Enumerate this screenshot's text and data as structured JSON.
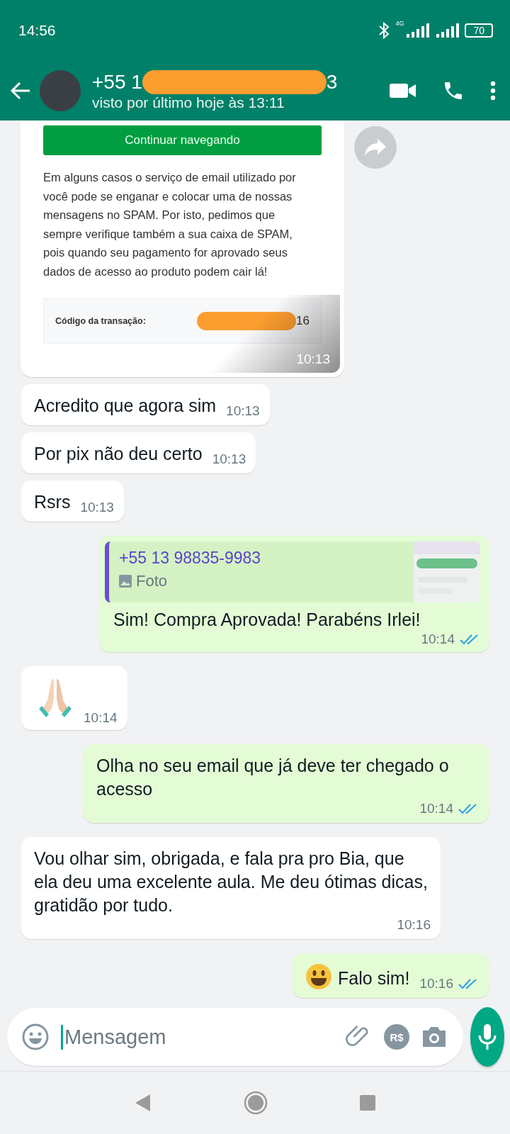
{
  "status_bar": {
    "time": "14:56",
    "network": "4G",
    "battery": "70"
  },
  "header": {
    "name_start": "+55 1",
    "name_end": "3",
    "last_seen": "visto por último hoje às 13:11"
  },
  "messages": [
    {
      "kind": "email_card",
      "outgoing": false,
      "button": "Continuar navegando",
      "body_lines": [
        "Em alguns casos o serviço de email utilizado por",
        "você pode se enganar e colocar uma de nossas",
        "mensagens no SPAM. Por isto, pedimos que",
        "sempre verifique também a sua caixa de SPAM,",
        "pois quando seu pagamento for aprovado seus",
        "dados de acesso ao produto podem cair lá!"
      ],
      "field_label": "Código da transação:",
      "field_value_end": "16",
      "time": "10:13"
    },
    {
      "kind": "text",
      "outgoing": false,
      "text": "Acredito que agora sim",
      "time": "10:13"
    },
    {
      "kind": "text",
      "outgoing": false,
      "text": "Por pix não deu certo",
      "time": "10:13"
    },
    {
      "kind": "text",
      "outgoing": false,
      "text": "Rsrs",
      "time": "10:13"
    },
    {
      "kind": "reply",
      "outgoing": true,
      "quote_author": "+55 13 98835-9983",
      "quote_type": "Foto",
      "text": "Sim! Compra Aprovada! Parabéns Irlei!",
      "time": "10:14",
      "read": true
    },
    {
      "kind": "emoji",
      "outgoing": false,
      "time": "10:14"
    },
    {
      "kind": "text",
      "outgoing": true,
      "text": "Olha no seu email que já deve ter chegado o acesso",
      "time": "10:14",
      "read": true
    },
    {
      "kind": "text",
      "outgoing": false,
      "text": "Vou olhar sim, obrigada,  e fala pra pro Bia, que ela deu uma excelente aula. Me deu ótimas dicas, gratidão por tudo.",
      "time": "10:16"
    },
    {
      "kind": "emoji_text",
      "outgoing": true,
      "text": "Falo sim!",
      "time": "10:16",
      "read": true
    }
  ],
  "composer": {
    "placeholder": "Mensagem",
    "pay_label": "R$"
  }
}
